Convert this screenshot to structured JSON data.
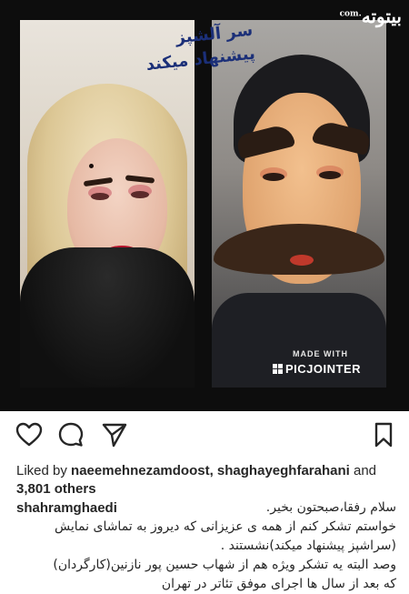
{
  "image": {
    "overlay_text": [
      "سر آلشپز",
      "پیشنهاد میکند"
    ],
    "watermark": {
      "made_with": "MADE WITH",
      "brand": "PICJOINTER"
    },
    "site_logo": {
      "text": "بيتوته",
      "suffix": ".com"
    }
  },
  "actions": {
    "like_icon": "heart-outline",
    "comment_icon": "speech-bubble",
    "share_icon": "paper-plane",
    "save_icon": "bookmark"
  },
  "likes": {
    "prefix": "Liked by ",
    "users": "naeemehnezamdoost, shaghayeghfarahani",
    "and": " and ",
    "count": "3,801 others"
  },
  "caption": {
    "username": "shahramghaedi",
    "lines": [
      "سلام رفقا،صبحتون بخیر.",
      "خواستم تشکر کنم از همه ی عزیزانی که دیروز به تماشای نمایش",
      "(سراشپز پیشنهاد میکند)نشستند .",
      "وصد البته یه تشکر ویژه هم از شهاب حسین پور نازنین(کارگردان)",
      "که بعد از سال ها اجرای موفق تئاتر در تهران"
    ]
  }
}
